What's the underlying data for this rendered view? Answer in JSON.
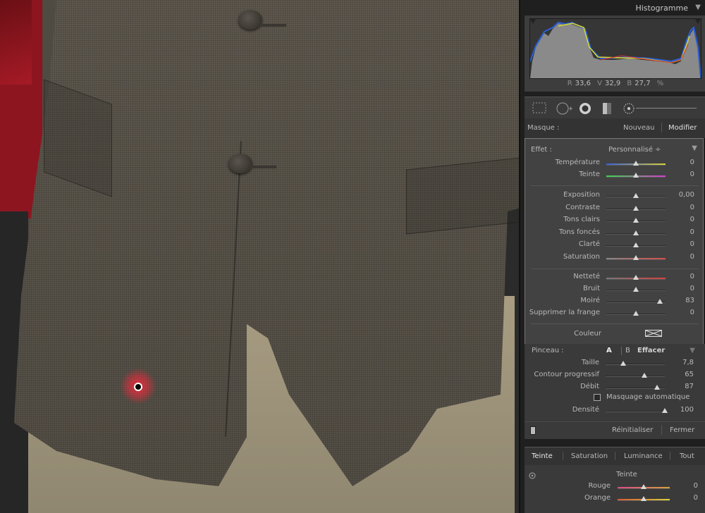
{
  "histogram": {
    "title": "Histogramme",
    "readout": {
      "r_label": "R",
      "r": "33,6",
      "v_label": "V",
      "v": "32,9",
      "b_label": "B",
      "b": "27,7",
      "unit": "%"
    }
  },
  "mask": {
    "label": "Masque :",
    "new": "Nouveau",
    "edit": "Modifier"
  },
  "effect": {
    "label": "Effet :",
    "preset": "Personnalisé ÷",
    "group1": [
      {
        "label": "Température",
        "value": "0",
        "pos": 0.5,
        "tint": "temp"
      },
      {
        "label": "Teinte",
        "value": "0",
        "pos": 0.5,
        "tint": "tint"
      }
    ],
    "group2": [
      {
        "label": "Exposition",
        "value": "0,00",
        "pos": 0.5
      },
      {
        "label": "Contraste",
        "value": "0",
        "pos": 0.5
      },
      {
        "label": "Tons clairs",
        "value": "0",
        "pos": 0.5
      },
      {
        "label": "Tons foncés",
        "value": "0",
        "pos": 0.5
      },
      {
        "label": "Clarté",
        "value": "0",
        "pos": 0.5
      },
      {
        "label": "Saturation",
        "value": "0",
        "pos": 0.5,
        "tint": "sat"
      }
    ],
    "group3": [
      {
        "label": "Netteté",
        "value": "0",
        "pos": 0.5,
        "tint": "sharp"
      },
      {
        "label": "Bruit",
        "value": "0",
        "pos": 0.5
      },
      {
        "label": "Moiré",
        "value": "83",
        "pos": 0.91
      },
      {
        "label": "Supprimer la frange",
        "value": "0",
        "pos": 0.5
      }
    ],
    "color_label": "Couleur"
  },
  "brush": {
    "label": "Pinceau :",
    "a": "A",
    "b": "B",
    "erase": "Effacer",
    "rows": [
      {
        "label": "Taille",
        "value": "7,8",
        "pos": 0.3
      },
      {
        "label": "Contour progressif",
        "value": "65",
        "pos": 0.65
      },
      {
        "label": "Débit",
        "value": "87",
        "pos": 0.87
      }
    ],
    "auto_mask": "Masquage automatique",
    "density": {
      "label": "Densité",
      "value": "100",
      "pos": 1.0
    },
    "reset": "Réinitialiser",
    "close": "Fermer"
  },
  "hsl": {
    "tabs": [
      "Teinte",
      "Saturation",
      "Luminance",
      "Tout"
    ],
    "section": "Teinte",
    "rows": [
      {
        "label": "Rouge",
        "value": "0",
        "pos": 0.5
      },
      {
        "label": "Orange",
        "value": "0",
        "pos": 0.5
      }
    ]
  }
}
